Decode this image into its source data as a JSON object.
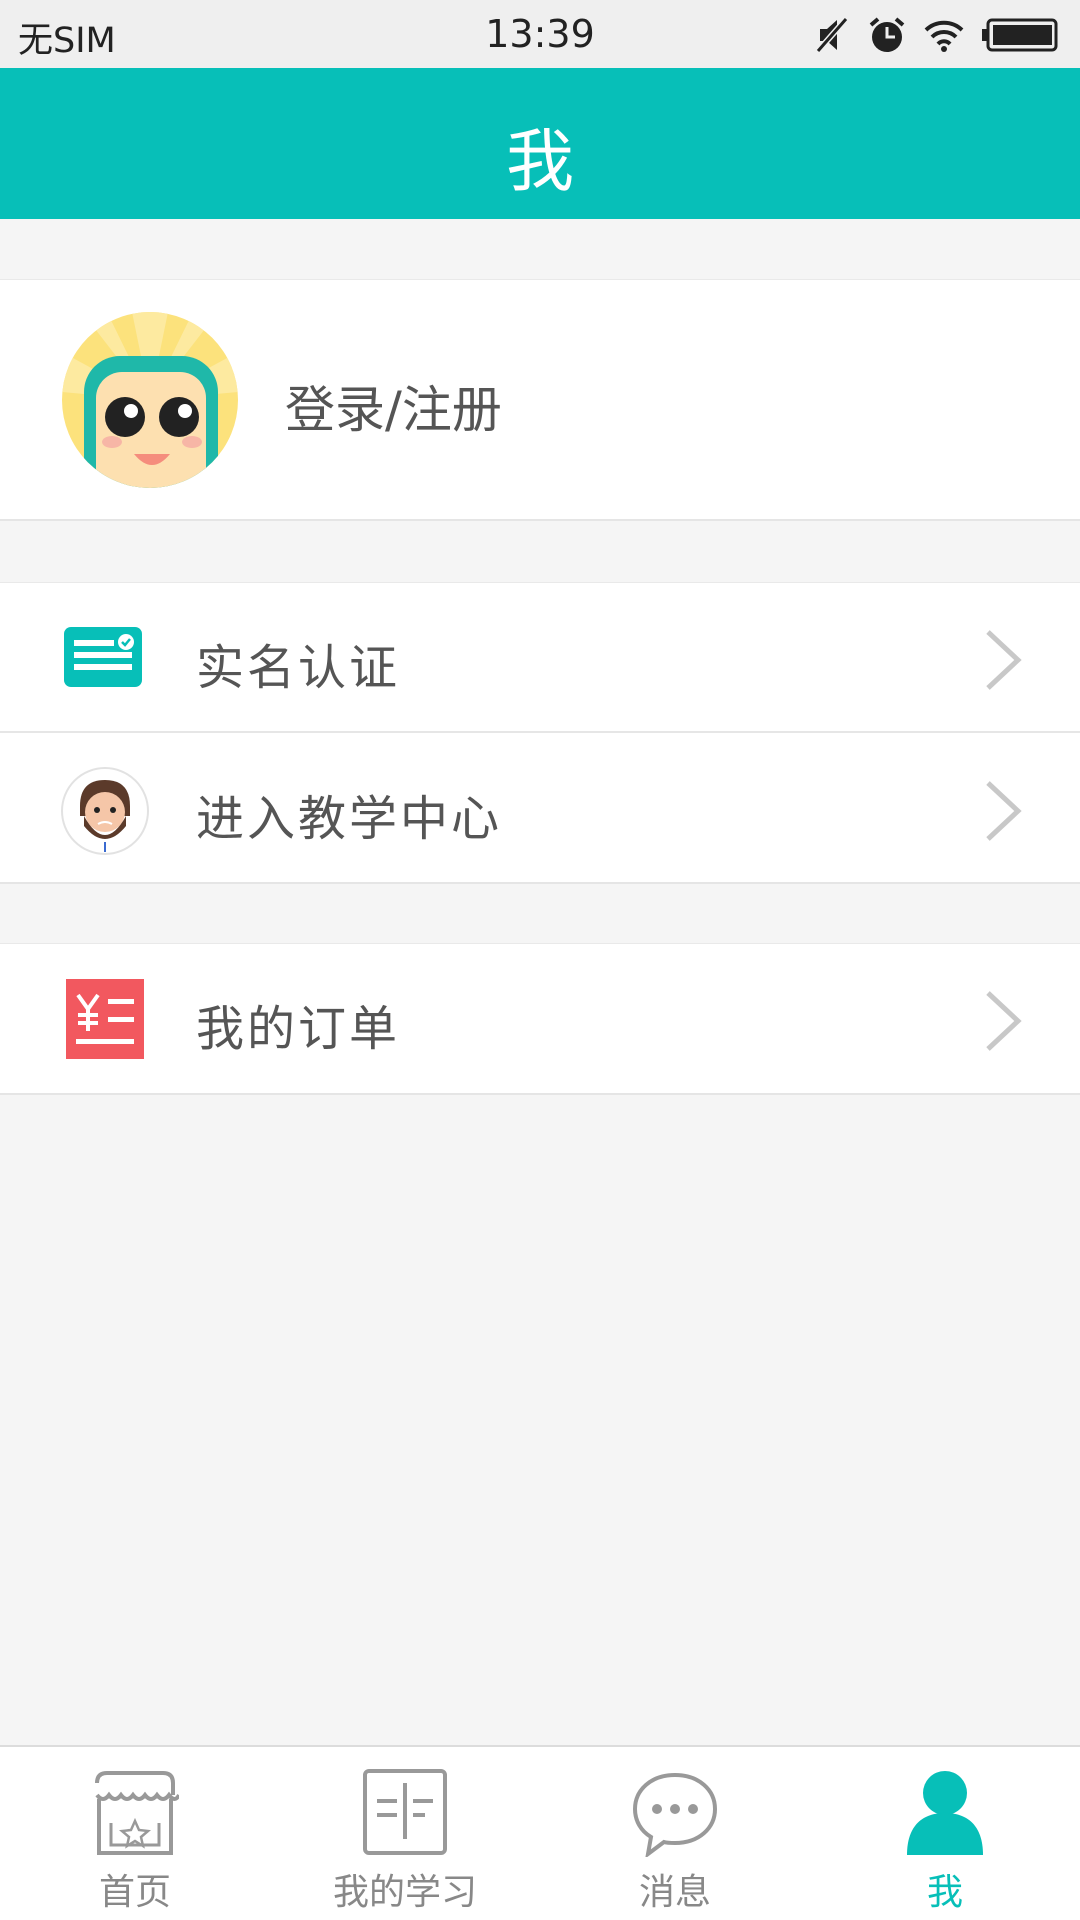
{
  "status_bar": {
    "carrier": "无SIM",
    "time": "13:39",
    "icons": [
      "mute-icon",
      "alarm-icon",
      "wifi-icon",
      "battery-icon"
    ]
  },
  "nav": {
    "title": "我"
  },
  "profile": {
    "login_label": "登录/注册",
    "avatar_icon": "cartoon-avatar-icon"
  },
  "menu": {
    "group1": [
      {
        "label": "实名认证",
        "icon": "id-card-icon"
      },
      {
        "label": "进入教学中心",
        "icon": "teacher-avatar-icon"
      }
    ],
    "group2": [
      {
        "label": "我的订单",
        "icon": "order-yuan-icon"
      }
    ]
  },
  "tabs": [
    {
      "label": "首页",
      "icon": "home-store-icon",
      "active": false
    },
    {
      "label": "我的学习",
      "icon": "book-icon",
      "active": false
    },
    {
      "label": "消息",
      "icon": "message-bubble-icon",
      "active": false
    },
    {
      "label": "我",
      "icon": "person-icon",
      "active": true
    }
  ],
  "colors": {
    "accent": "#07bfb8",
    "order_red": "#f2585f",
    "background": "#f5f5f5"
  }
}
